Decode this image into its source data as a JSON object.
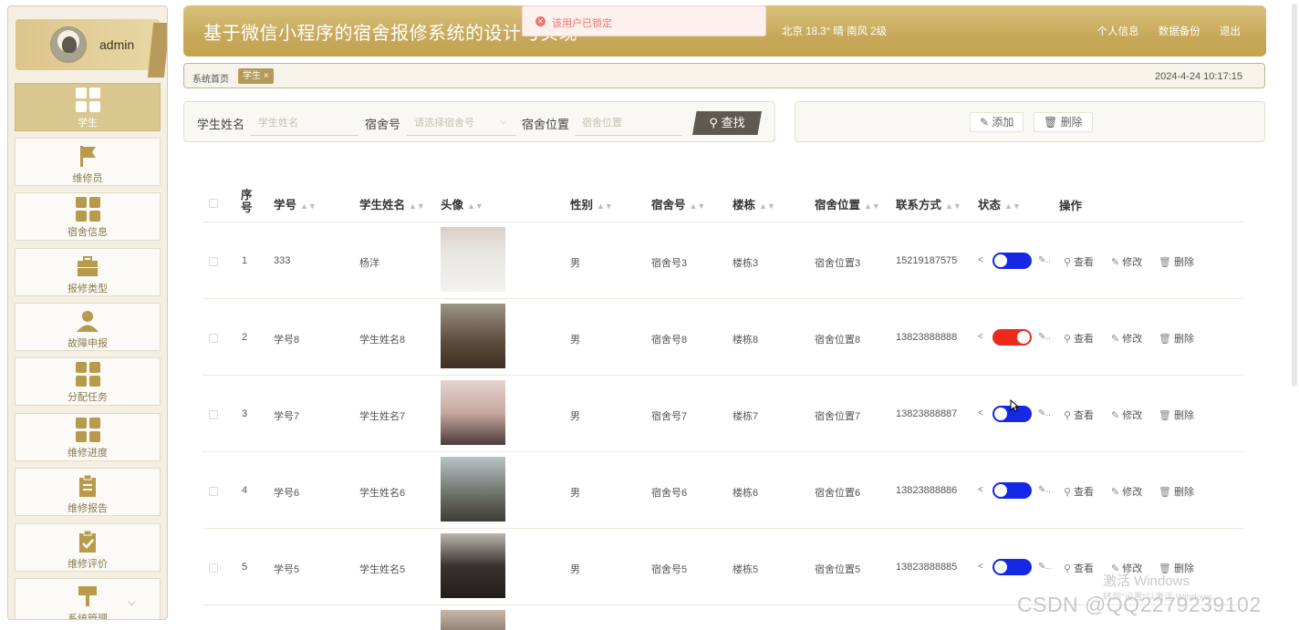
{
  "user": {
    "name": "admin"
  },
  "sidebar": {
    "items": [
      {
        "label": "学生",
        "icon": "grid-icon",
        "active": true
      },
      {
        "label": "维修员",
        "icon": "flag-icon"
      },
      {
        "label": "宿舍信息",
        "icon": "grid-icon"
      },
      {
        "label": "报修类型",
        "icon": "briefcase-icon"
      },
      {
        "label": "故障申报",
        "icon": "person-icon"
      },
      {
        "label": "分配任务",
        "icon": "grid-icon"
      },
      {
        "label": "维修进度",
        "icon": "grid-icon"
      },
      {
        "label": "维修报告",
        "icon": "clipboard-icon"
      },
      {
        "label": "维修评价",
        "icon": "clipboard-check-icon"
      },
      {
        "label": "系统管理",
        "icon": "brush-icon"
      }
    ]
  },
  "header": {
    "title": "基于微信小程序的宿舍报修系统的设计与实现",
    "weather": "北京  18.3°  晴  南风  2级",
    "nav": [
      "个人信息",
      "数据备份",
      "退出"
    ]
  },
  "toast": {
    "message": "该用户已锁定"
  },
  "breadcrumb": {
    "home": "系统首页",
    "tag": "学生 ×",
    "datetime": "2024-4-24 10:17:15"
  },
  "search": {
    "name_label": "学生姓名",
    "name_placeholder": "学生姓名",
    "room_label": "宿舍号",
    "room_placeholder": "请选择宿舍号",
    "location_label": "宿舍位置",
    "location_placeholder": "宿舍位置",
    "button": "查找"
  },
  "actions": {
    "add": "添加",
    "delete": "删除"
  },
  "table": {
    "headers": [
      "序号",
      "学号",
      "学生姓名",
      "头像",
      "性别",
      "宿舍号",
      "楼栋",
      "宿舍位置",
      "联系方式",
      "状态",
      "操作"
    ],
    "ops": {
      "view": "查看",
      "edit": "修改",
      "delete": "删除"
    },
    "rows": [
      {
        "index": "1",
        "id": "333",
        "name": "杨洋",
        "gender": "男",
        "room": "宿舍号3",
        "building": "楼栋3",
        "location": "宿舍位置3",
        "phone": "15219187575",
        "locked": false
      },
      {
        "index": "2",
        "id": "学号8",
        "name": "学生姓名8",
        "gender": "男",
        "room": "宿舍号8",
        "building": "楼栋8",
        "location": "宿舍位置8",
        "phone": "13823888888",
        "locked": true
      },
      {
        "index": "3",
        "id": "学号7",
        "name": "学生姓名7",
        "gender": "男",
        "room": "宿舍号7",
        "building": "楼栋7",
        "location": "宿舍位置7",
        "phone": "13823888887",
        "locked": false
      },
      {
        "index": "4",
        "id": "学号6",
        "name": "学生姓名6",
        "gender": "男",
        "room": "宿舍号6",
        "building": "楼栋6",
        "location": "宿舍位置6",
        "phone": "13823888886",
        "locked": false
      },
      {
        "index": "5",
        "id": "学号5",
        "name": "学生姓名5",
        "gender": "男",
        "room": "宿舍号5",
        "building": "楼栋5",
        "location": "宿舍位置5",
        "phone": "13823888885",
        "locked": false
      }
    ]
  },
  "watermark": {
    "line1": "激活 Windows",
    "line2": "转到\"设置\"以激活 Windows。",
    "csdn": "CSDN @QQ2279239102"
  },
  "colors": {
    "accent": "#c6a859",
    "toggle_off": "#1428e6",
    "toggle_on": "#ee2a1a"
  }
}
